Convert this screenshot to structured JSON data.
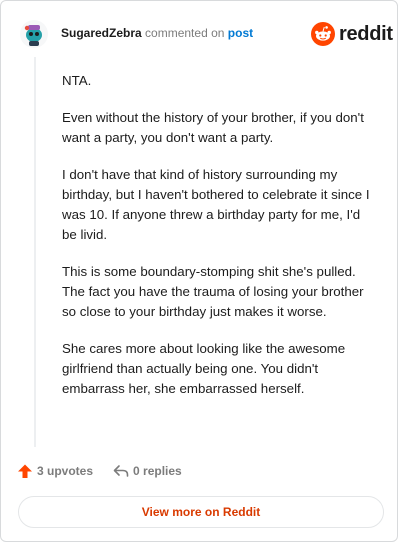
{
  "comment": {
    "username": "SugaredZebra",
    "action_text": "commented on",
    "post_link": "post",
    "paragraphs": [
      "NTA.",
      "Even without the history of your brother, if you don't want a party, you don't want a party.",
      "I don't have that kind of history surrounding my birthday, but I haven't bothered to celebrate it since I was 10. If anyone threw a birthday party for me, I'd be livid.",
      "This is some boundary-stomping shit she's pulled. The fact you have the trauma of losing your brother so close to your birthday just makes it worse.",
      "She cares more about looking like the awesome girlfriend than actually being one. You didn't embarrass her, she embarrassed herself."
    ]
  },
  "brand": {
    "name": "reddit",
    "icon": "reddit-logo-icon",
    "color": "#ff4500"
  },
  "actions": {
    "upvotes_label": "3 upvotes",
    "replies_label": "0 replies",
    "upvote_icon": "upvote-arrow-icon",
    "reply_icon": "reply-arrow-icon",
    "upvote_color": "#ff4500"
  },
  "footer": {
    "view_more_label": "View more on Reddit"
  },
  "colors": {
    "link": "#0079d3",
    "view_more": "#d93a00",
    "muted": "#7c7c7c"
  }
}
